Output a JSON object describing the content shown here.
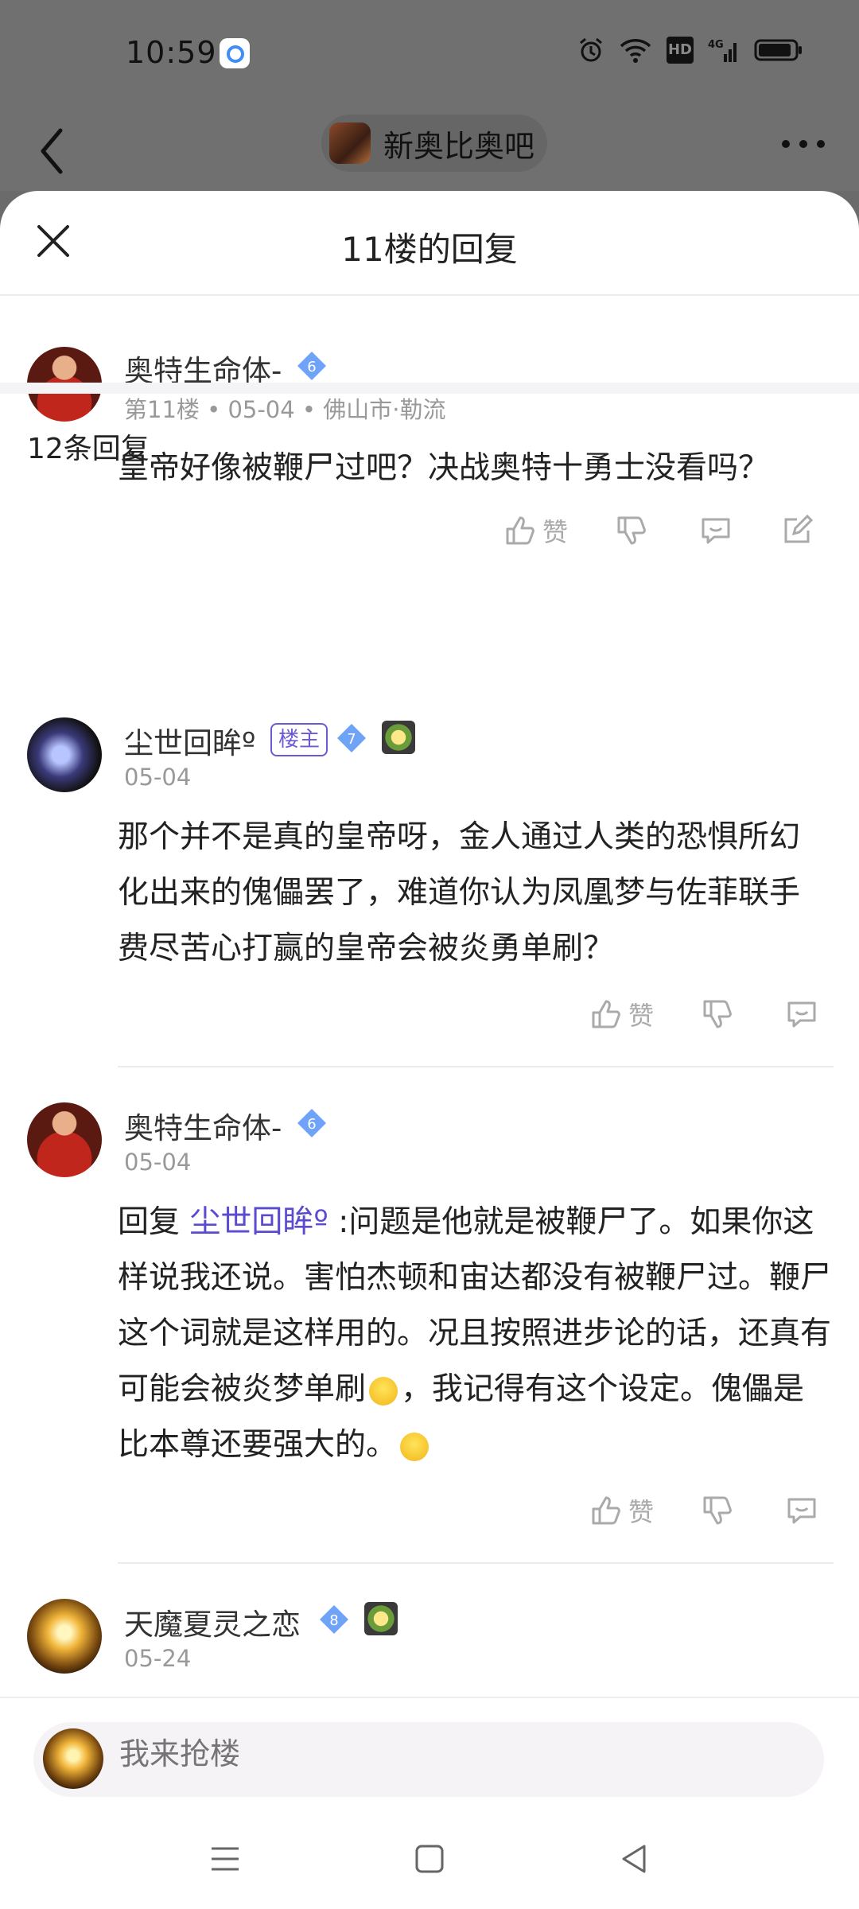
{
  "status_bar": {
    "time": "10:59",
    "network": "4G"
  },
  "top_bar": {
    "forum_name": "新奥比奥吧"
  },
  "sheet": {
    "title": "11楼的回复"
  },
  "main_post": {
    "username": "奥特生命体-",
    "level": "6",
    "meta": "第11楼 • 05-04 • 佛山市·勒流",
    "content": "皇帝好像被鞭尸过吧？决战奥特十勇士没看吗？",
    "like_label": "赞"
  },
  "replies_header": {
    "count_label": "12条回复"
  },
  "replies": [
    {
      "username": "尘世回眸º",
      "host_tag": "楼主",
      "level": "7",
      "date": "05-04",
      "content": "那个并不是真的皇帝呀，金人通过人类的恐惧所幻化出来的傀儡罢了，难道你认为凤凰梦与佐菲联手费尽苦心打赢的皇帝会被炎勇单刷？",
      "like_label": "赞"
    },
    {
      "username": "奥特生命体-",
      "level": "6",
      "date": "05-04",
      "reply_prefix": "回复",
      "reply_to": "尘世回眸º",
      "content_a": " :问题是他就是被鞭尸了。如果你这样说我还说。害怕杰顿和宙达都没有被鞭尸过。鞭尸这个词就是这样用的。况且按照进步论的话，还真有可能会被炎梦单刷",
      "content_b": "，我记得有这个设定。傀儡是比本尊还要强大的。",
      "like_label": "赞"
    },
    {
      "username": "天魔夏灵之恋",
      "level": "8",
      "date": "05-24"
    }
  ],
  "composer": {
    "placeholder": "我来抢楼"
  },
  "colors": {
    "accent": "#5b4bd1",
    "level_badge": "#6fa3f7",
    "icon_gray": "#aaaaaa"
  }
}
